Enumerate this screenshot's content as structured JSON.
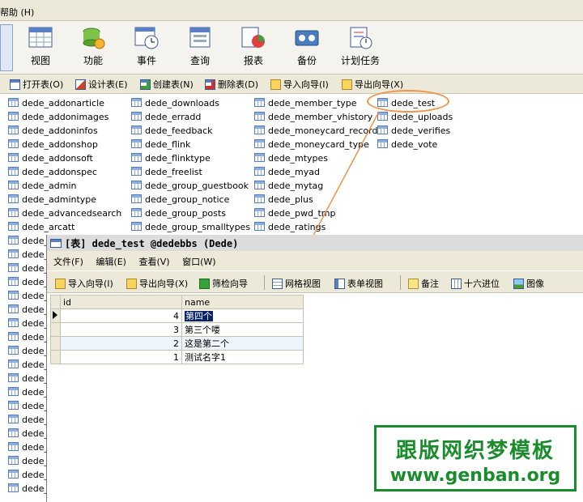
{
  "menubar": {
    "help_label": "帮助 (H)"
  },
  "iconbar": {
    "buttons": [
      {
        "label": "视图",
        "icon": "view-icon"
      },
      {
        "label": "功能",
        "icon": "function-icon"
      },
      {
        "label": "事件",
        "icon": "event-icon"
      },
      {
        "label": "查询",
        "icon": "query-icon"
      },
      {
        "label": "报表",
        "icon": "report-icon"
      },
      {
        "label": "备份",
        "icon": "backup-icon"
      },
      {
        "label": "计划任务",
        "icon": "schedule-icon"
      }
    ]
  },
  "toolbar": {
    "open_table": "打开表(O)",
    "design_table": "设计表(E)",
    "create_table": "创建表(N)",
    "delete_table": "删除表(D)",
    "import_wizard": "导入向导(I)",
    "export_wizard": "导出向导(X)"
  },
  "tables": {
    "col1": [
      "dede_addonarticle",
      "dede_addonimages",
      "dede_addoninfos",
      "dede_addonshop",
      "dede_addonsoft",
      "dede_addonspec",
      "dede_admin",
      "dede_admintype",
      "dede_advancedsearch",
      "dede_arcatt",
      "dede_",
      "dede_",
      "dede_",
      "dede_",
      "dede_",
      "dede_",
      "dede_",
      "dede_",
      "dede_",
      "dede_",
      "dede_",
      "dede_",
      "dede_",
      "dede_",
      "dede_",
      "dede_",
      "dede_",
      "dede_",
      "dede_"
    ],
    "col2": [
      "dede_downloads",
      "dede_erradd",
      "dede_feedback",
      "dede_flink",
      "dede_flinktype",
      "dede_freelist",
      "dede_group_guestbook",
      "dede_group_notice",
      "dede_group_posts",
      "dede_group_smalltypes"
    ],
    "col3": [
      "dede_member_type",
      "dede_member_vhistory",
      "dede_moneycard_record",
      "dede_moneycard_type",
      "dede_mtypes",
      "dede_myad",
      "dede_mytag",
      "dede_plus",
      "dede_pwd_tmp",
      "dede_ratings"
    ],
    "col4": [
      "dede_test",
      "dede_uploads",
      "dede_verifies",
      "dede_vote"
    ]
  },
  "subwindow": {
    "title": "[表] dede_test @dedebbs (Dede)",
    "menu": {
      "file": "文件(F)",
      "edit": "编辑(E)",
      "view": "查看(V)",
      "window": "窗口(W)"
    },
    "toolbar": {
      "import": "导入向导(I)",
      "export": "导出向导(X)",
      "filter": "筛检向导",
      "grid_view": "网格视图",
      "form_view": "表单视图",
      "memo": "备注",
      "hex": "十六进位",
      "image": "图像"
    },
    "grid": {
      "columns": [
        "id",
        "name"
      ],
      "rows": [
        {
          "id": "4",
          "name": "第四个"
        },
        {
          "id": "3",
          "name": "第三个喽"
        },
        {
          "id": "2",
          "name": "这是第二个"
        },
        {
          "id": "1",
          "name": "测试名字1"
        }
      ]
    }
  },
  "watermark": {
    "line1": "跟版网织梦模板",
    "line2": "www.genban.org"
  },
  "colors": {
    "annotation": "#f0934a",
    "watermark_green": "#1a8c2c",
    "selection": "#0a246a"
  }
}
